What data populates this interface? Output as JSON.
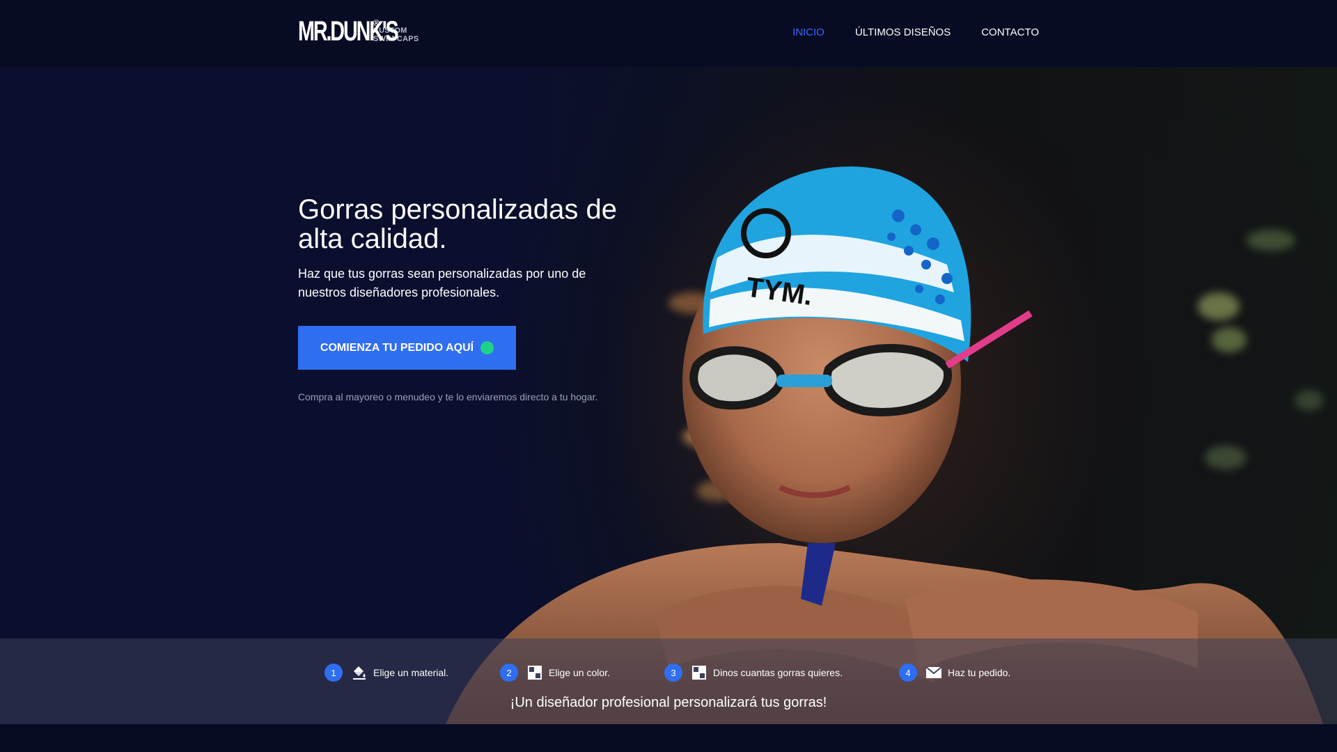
{
  "header": {
    "logo": {
      "main": "MR.DUNK'S",
      "registered": "®",
      "sub_line1": "CUSTOM",
      "sub_line2": "SWIM CAPS"
    },
    "nav": [
      {
        "label": "INICIO",
        "active": true
      },
      {
        "label": "ÚLTIMOS DISEÑOS",
        "active": false
      },
      {
        "label": "CONTACTO",
        "active": false
      }
    ]
  },
  "hero": {
    "title": "Gorras personalizadas de alta calidad.",
    "subtitle": "Haz que tus gorras sean personalizadas por uno de nuestros diseñadores profesionales.",
    "cta_label": "COMIENZA TU PEDIDO AQUÍ",
    "note": "Compra al mayoreo o menudeo y te lo enviaremos directo a tu hogar.",
    "cap_text": "TYM."
  },
  "steps": [
    {
      "number": "1",
      "icon": "paint-bucket-icon",
      "label": "Elige un material."
    },
    {
      "number": "2",
      "icon": "grid-icon",
      "label": "Elige un color."
    },
    {
      "number": "3",
      "icon": "grid-icon",
      "label": "Dinos cuantas gorras quieres."
    },
    {
      "number": "4",
      "icon": "envelope-icon",
      "label": "Haz tu pedido."
    }
  ],
  "tagline": "¡Un diseñador profesional personalizará tus gorras!",
  "colors": {
    "background": "#070c24",
    "accent_blue": "#2f6ef0",
    "nav_active": "#3b63ff",
    "cta_dot": "#1fd28a"
  }
}
